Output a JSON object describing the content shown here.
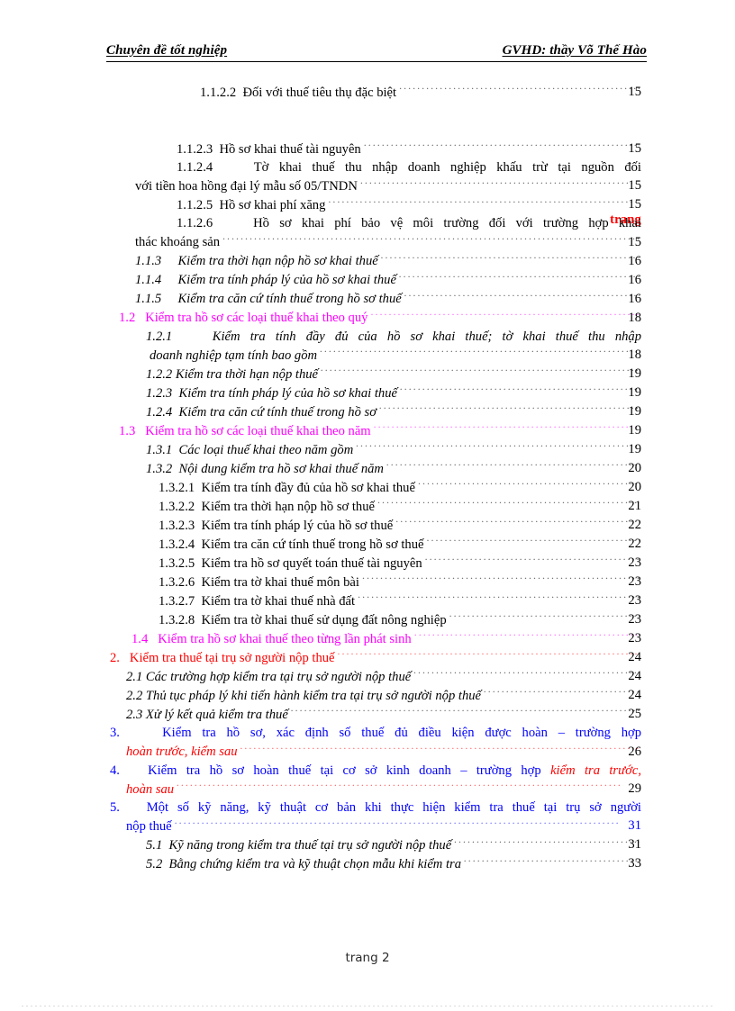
{
  "header": {
    "left": "Chuyên đề tốt nghiệp",
    "right": "GVHD: thầy Võ Thế Hào"
  },
  "page_column_label": "trang",
  "colors": {
    "black": "#000000",
    "magenta": "#ff00ff",
    "red": "#ff0000",
    "blue": "#0000ff"
  },
  "footer": {
    "text": "trang 2"
  },
  "toc": {
    "entries": [
      {
        "number": "1.1.2.2",
        "text": "Đối với thuế tiêu thụ đặc biệt",
        "page": "15"
      },
      {
        "number": "1.1.2.3",
        "text": "Hồ sơ khai thuế tài nguyên",
        "page": "15"
      },
      {
        "number": "1.1.2.4",
        "text": "Tờ khai thuế thu nhập doanh nghiệp khấu trừ tại nguồn đối",
        "cont": "với tiền hoa hồng đại lý mẫu số 05/TNDN",
        "page": "15"
      },
      {
        "number": "1.1.2.5",
        "text": "Hồ sơ khai phí xăng",
        "page": "15"
      },
      {
        "number": "1.1.2.6",
        "text": "Hồ sơ khai phí bảo vệ môi trường đối với trường hợp khai",
        "cont": "thác khoáng sản",
        "page": "15"
      },
      {
        "number": "1.1.3",
        "text": "Kiểm tra thời hạn nộp hồ sơ khai thuế",
        "page": "16"
      },
      {
        "number": "1.1.4",
        "text": "Kiểm tra tính pháp lý của hồ sơ khai thuế",
        "page": "16"
      },
      {
        "number": "1.1.5",
        "text": "Kiểm tra căn cứ tính thuế trong hồ sơ thuế",
        "page": "16"
      },
      {
        "number": "1.2",
        "text": "Kiểm tra hồ sơ các loại thuế khai theo quý",
        "page": "18"
      },
      {
        "number": "1.2.1",
        "text": "Kiểm tra tính đầy đủ của hồ sơ khai thuế; tờ khai thuế thu nhập",
        "cont": "doanh nghiệp tạm tính bao gồm",
        "page": "18"
      },
      {
        "number": "1.2.2",
        "text": "Kiểm tra thời hạn nộp thuế",
        "page": "19"
      },
      {
        "number": "1.2.3",
        "text": "Kiểm tra tính pháp lý của hồ sơ khai thuế",
        "page": "19"
      },
      {
        "number": "1.2.4",
        "text": "Kiểm tra căn cứ tính thuế trong hồ sơ",
        "page": "19"
      },
      {
        "number": "1.3",
        "text": "Kiểm tra hồ sơ các loại thuế khai theo năm",
        "page": "19"
      },
      {
        "number": "1.3.1",
        "text": "Các loại thuế khai theo năm gồm",
        "page": "19"
      },
      {
        "number": "1.3.2",
        "text": "Nội dung kiểm tra hồ sơ khai thuế năm",
        "page": "20"
      },
      {
        "number": "1.3.2.1",
        "text": "Kiểm tra tính đầy đủ của hồ sơ khai  thuế",
        "page": "20"
      },
      {
        "number": "1.3.2.2",
        "text": "Kiểm tra thời hạn nộp hồ sơ thuế",
        "page": "21"
      },
      {
        "number": "1.3.2.3",
        "text": "Kiểm tra tính pháp  lý của hồ sơ thuế",
        "page": "22"
      },
      {
        "number": "1.3.2.4",
        "text": "Kiểm tra căn cứ tính thuế trong hồ sơ thuế",
        "page": "22"
      },
      {
        "number": "1.3.2.5",
        "text": "Kiểm tra hồ sơ quyết toán thuế tài nguyên",
        "page": "23"
      },
      {
        "number": "1.3.2.6",
        "text": "Kiểm tra tờ khai thuế môn bài",
        "page": "23"
      },
      {
        "number": "1.3.2.7",
        "text": "Kiểm tra tờ khai thuế nhà đất",
        "page": "23"
      },
      {
        "number": "1.3.2.8",
        "text": "Kiểm tra tờ khai thuế sử dụng đất nông nghiệp",
        "page": "23"
      },
      {
        "number": "1.4",
        "text": "Kiểm tra hồ sơ khai thuế theo từng lần phát sinh",
        "page": "23"
      },
      {
        "number": "2.",
        "text": "Kiểm tra thuế tại trụ sở người nộp thuế",
        "page": "24"
      },
      {
        "number": "2.1",
        "text": "Các trường hợp kiểm tra tại trụ sở người nộp thuế",
        "page": "24"
      },
      {
        "number": "2.2",
        "text": "Thủ tục pháp lý khi tiến hành kiểm tra tại trụ sở người nộp thuế",
        "page": "24"
      },
      {
        "number": "2.3",
        "text": "Xử lý kết quả kiểm tra thuế",
        "page": "25"
      },
      {
        "number": "3.",
        "text": "Kiểm tra hồ sơ, xác định số thuế đủ điều kiện được hoàn – trường hợp",
        "cont": "hoàn  trước, kiểm sau",
        "page": "26"
      },
      {
        "number": "4.",
        "text": "Kiểm tra hồ sơ hoàn thuế tại cơ sở kinh doanh – trường hợp ",
        "text_emph": "kiểm tra trước,",
        "cont": "hoàn sau",
        "page": "29"
      },
      {
        "number": "5.",
        "text": "Một số kỹ năng, kỹ thuật cơ bản khi thực hiện kiểm tra thuế tại trụ sở người",
        "cont": "nộp thuế",
        "page": "31"
      },
      {
        "number": "5.1",
        "text": "Kỹ năng trong kiểm tra thuế tại trụ sở người nộp thuế",
        "page": "31"
      },
      {
        "number": "5.2",
        "text": "Bằng chứng kiểm tra và kỹ thuật chọn mẫu khi kiểm tra",
        "page": "33"
      }
    ]
  }
}
